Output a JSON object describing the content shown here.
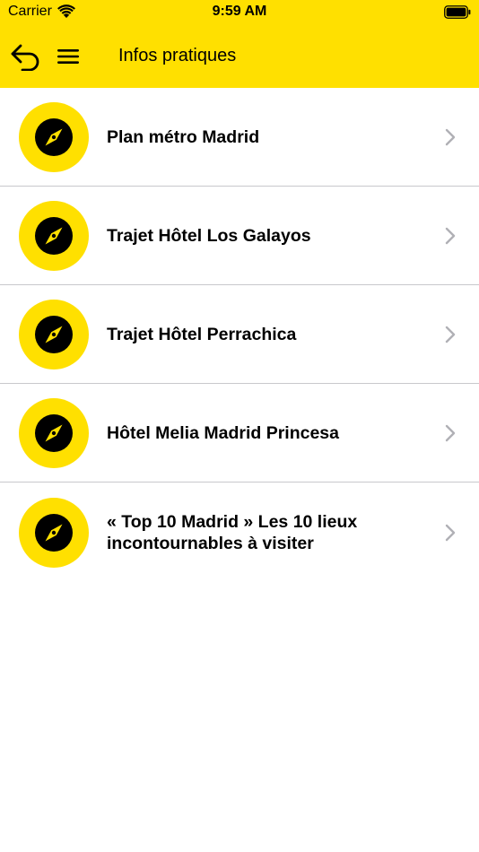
{
  "status_bar": {
    "carrier": "Carrier",
    "time": "9:59 AM"
  },
  "header": {
    "title": "Infos pratiques",
    "back_icon": "back-arrow-icon",
    "menu_icon": "hamburger-menu-icon",
    "background_color": "#FFE000"
  },
  "list": {
    "icon": "compass-icon",
    "items": [
      {
        "label": "Plan métro Madrid"
      },
      {
        "label": "Trajet Hôtel Los Galayos"
      },
      {
        "label": "Trajet Hôtel Perrachica"
      },
      {
        "label": "Hôtel Melia Madrid Princesa"
      },
      {
        "label": "« Top 10 Madrid » Les 10 lieux incontournables à visiter"
      }
    ]
  }
}
